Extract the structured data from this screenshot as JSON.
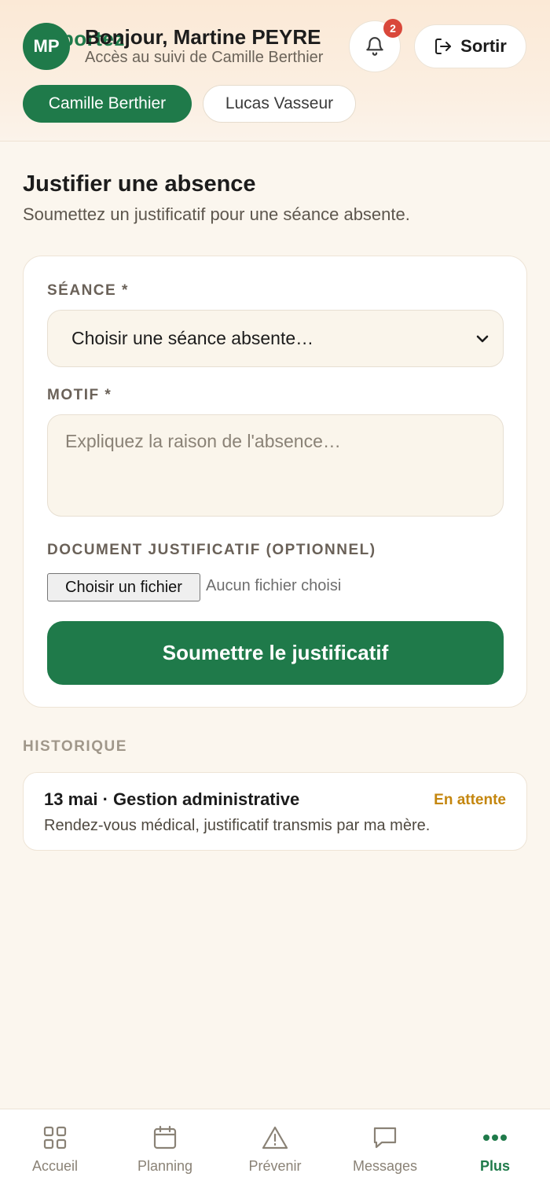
{
  "header": {
    "brand_behind": "Sportez",
    "avatar_initials": "MP",
    "greeting": "Bonjour, Martine PEYRE",
    "subtitle": "Accès au suivi de Camille Berthier",
    "notification_count": "2",
    "logout_label": "Sortir"
  },
  "children": [
    {
      "label": "Camille Berthier",
      "active": true
    },
    {
      "label": "Lucas Vasseur",
      "active": false
    }
  ],
  "page": {
    "title": "Justifier une absence",
    "subtitle": "Soumettez un justificatif pour une séance absente."
  },
  "form": {
    "session_label": "SÉANCE *",
    "session_value": "Choisir une séance absente…",
    "reason_label": "MOTIF *",
    "reason_placeholder": "Expliquez la raison de l'absence…",
    "document_label": "DOCUMENT JUSTIFICATIF (OPTIONNEL)",
    "file_button": "Choisir un fichier",
    "file_status": "Aucun fichier choisi",
    "submit_label": "Soumettre le justificatif"
  },
  "history": {
    "title": "HISTORIQUE",
    "items": [
      {
        "title": "13 mai · Gestion administrative",
        "status": "En attente",
        "description": "Rendez-vous médical, justificatif transmis par ma mère."
      }
    ]
  },
  "nav": {
    "items": [
      {
        "label": "Accueil",
        "icon": "grid-icon"
      },
      {
        "label": "Planning",
        "icon": "calendar-icon"
      },
      {
        "label": "Prévenir",
        "icon": "warning-icon"
      },
      {
        "label": "Messages",
        "icon": "message-icon"
      },
      {
        "label": "Plus",
        "icon": "more-icon",
        "active": true
      }
    ]
  },
  "colors": {
    "primary": "#1f7a4a",
    "badge": "#d9473a",
    "pending": "#c4860e",
    "background": "#fbf6ee"
  }
}
